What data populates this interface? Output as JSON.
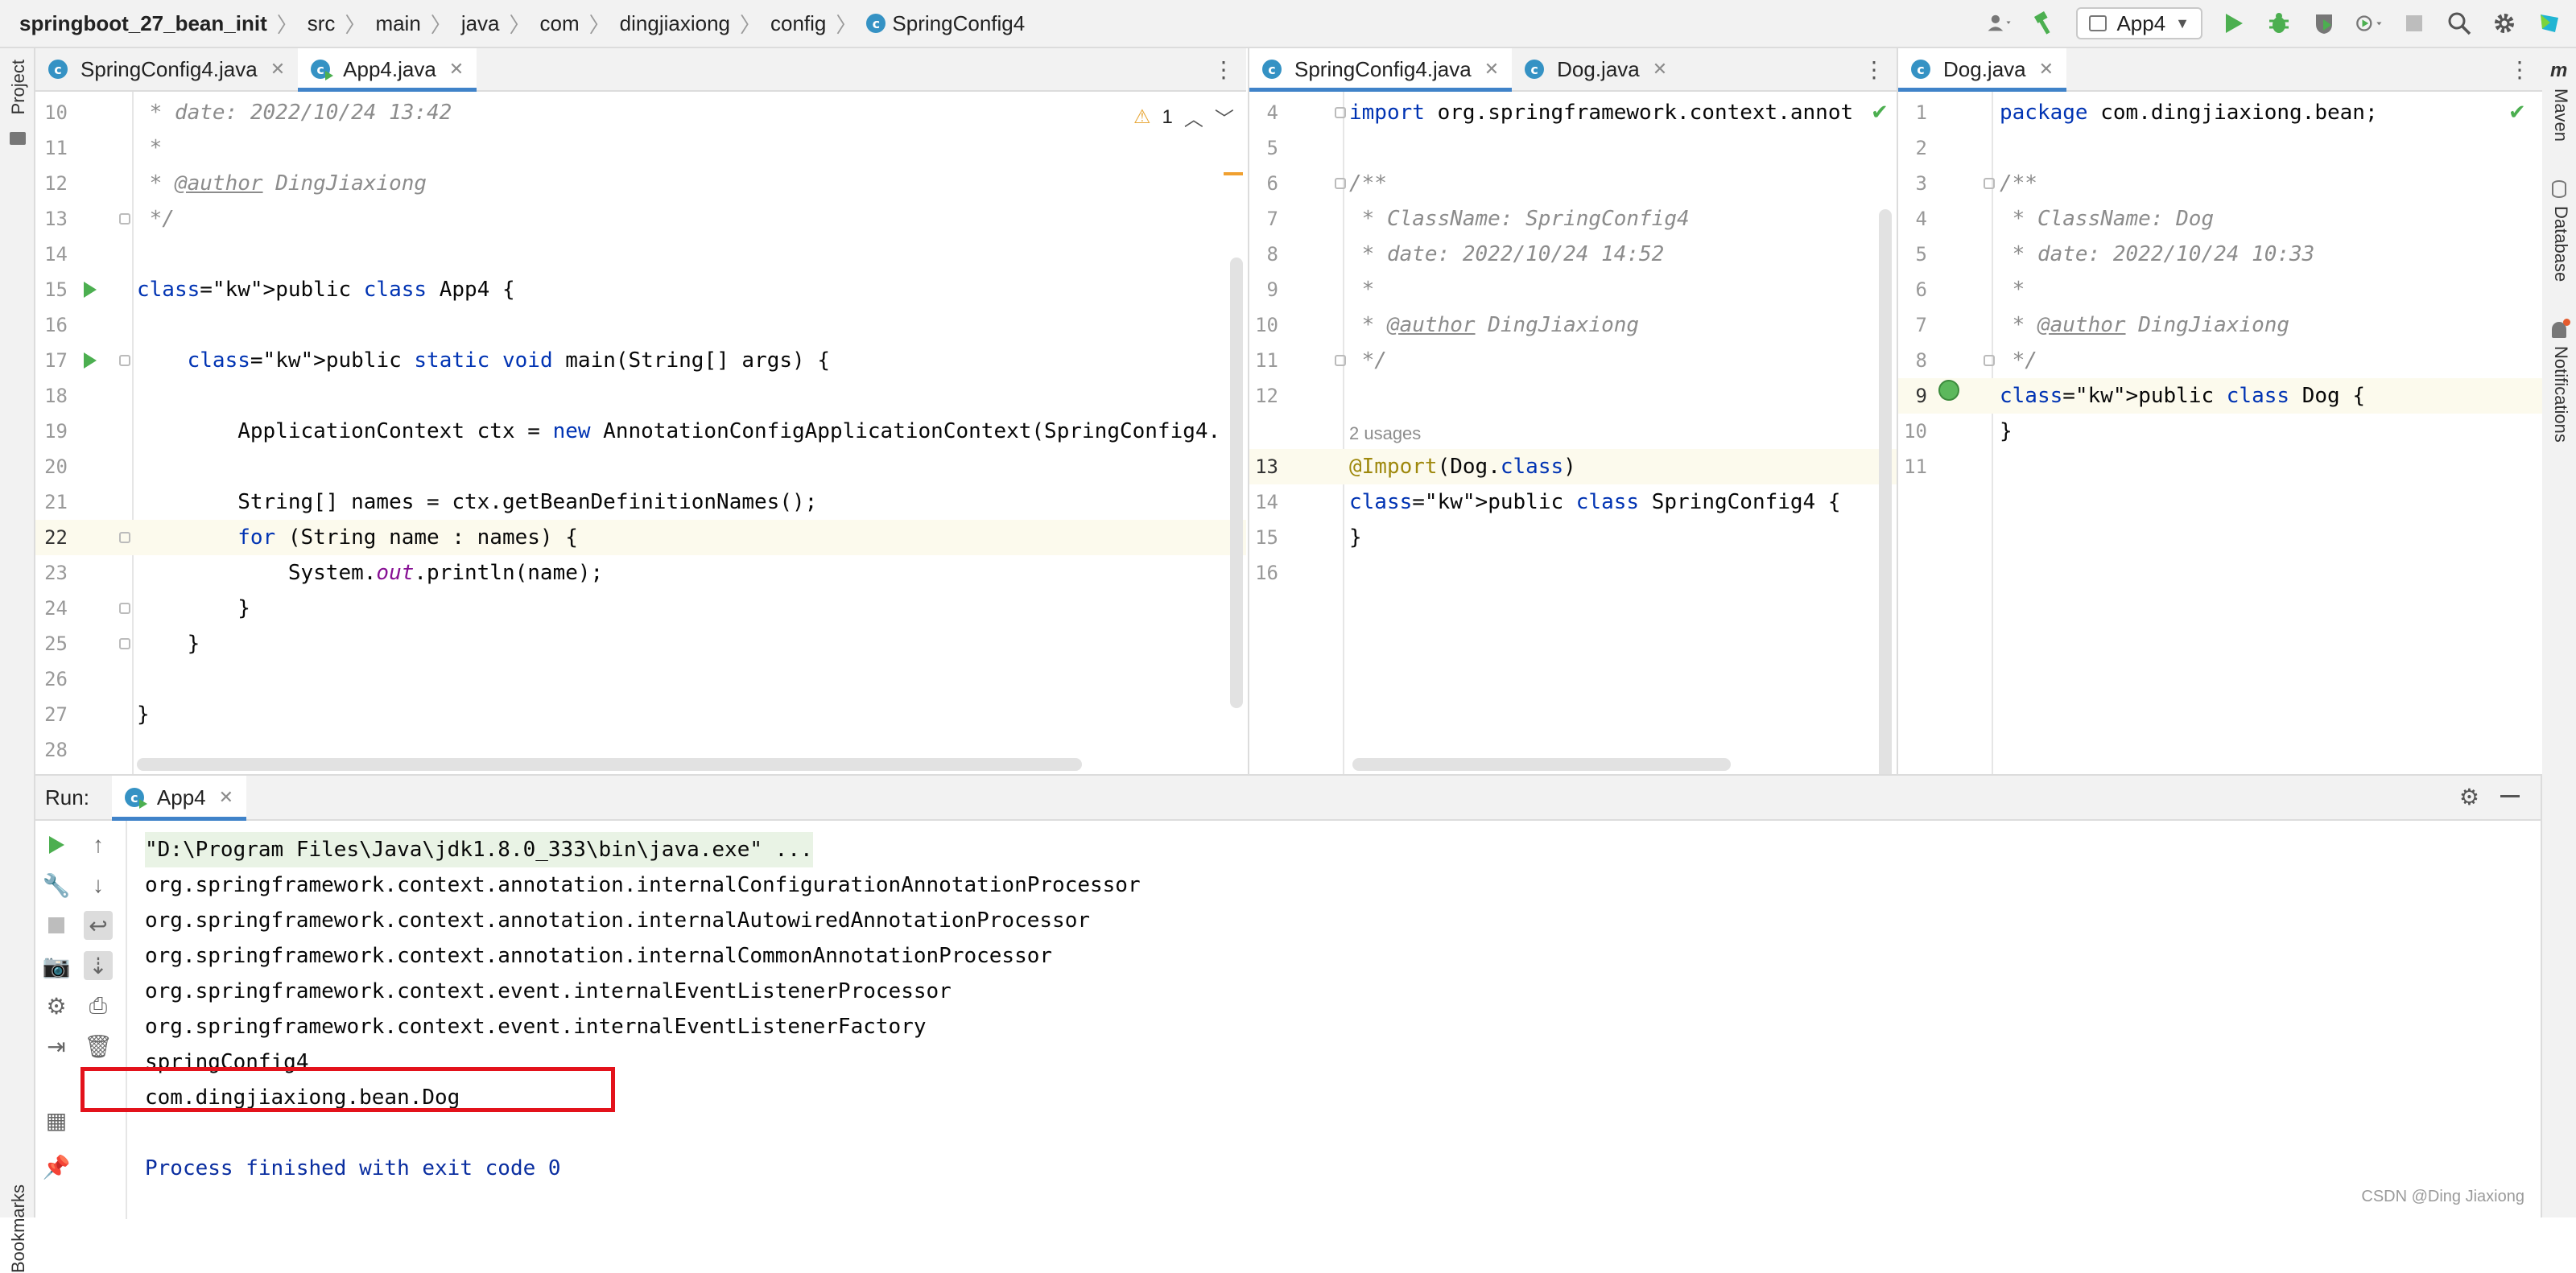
{
  "breadcrumb": [
    "springboot_27_bean_init",
    "src",
    "main",
    "java",
    "com",
    "dingjiaxiong",
    "config",
    "SpringConfig4"
  ],
  "toolbar": {
    "run_config": "App4",
    "icons": [
      "user-icon",
      "hammer-icon",
      "run-icon",
      "debug-icon",
      "coverage-icon",
      "profile-icon",
      "stop-icon",
      "search-icon",
      "gear-icon",
      "jetbrains-icon"
    ]
  },
  "left_stripe": {
    "project": "Project",
    "bookmarks": "Bookmarks"
  },
  "right_stripe": {
    "maven": "Maven",
    "database": "Database",
    "notifications": "Notifications"
  },
  "editor1": {
    "tabs": [
      {
        "label": "SpringConfig4.java",
        "active": false
      },
      {
        "label": "App4.java",
        "active": true
      }
    ],
    "warning_count": "1",
    "lines": [
      {
        "n": "10",
        "text": " * date: 2022/10/24 13:42"
      },
      {
        "n": "11",
        "text": " *"
      },
      {
        "n": "12",
        "text": " * @author DingJiaxiong"
      },
      {
        "n": "13",
        "text": " */"
      },
      {
        "n": "14",
        "text": ""
      },
      {
        "n": "15",
        "text": "public class App4 {"
      },
      {
        "n": "16",
        "text": ""
      },
      {
        "n": "17",
        "text": "    public static void main(String[] args) {"
      },
      {
        "n": "18",
        "text": ""
      },
      {
        "n": "19",
        "text": "        ApplicationContext ctx = new AnnotationConfigApplicationContext(SpringConfig4."
      },
      {
        "n": "20",
        "text": ""
      },
      {
        "n": "21",
        "text": "        String[] names = ctx.getBeanDefinitionNames();"
      },
      {
        "n": "22",
        "text": "        for (String name : names) {"
      },
      {
        "n": "23",
        "text": "            System.out.println(name);"
      },
      {
        "n": "24",
        "text": "        }"
      },
      {
        "n": "25",
        "text": "    }"
      },
      {
        "n": "26",
        "text": ""
      },
      {
        "n": "27",
        "text": "}"
      },
      {
        "n": "28",
        "text": ""
      }
    ]
  },
  "editor2": {
    "tabs": [
      {
        "label": "SpringConfig4.java",
        "active": true
      },
      {
        "label": "Dog.java",
        "active": false
      }
    ],
    "usages": "2 usages",
    "lines": [
      {
        "n": "4",
        "text": "import org.springframework.context.annot"
      },
      {
        "n": "5",
        "text": ""
      },
      {
        "n": "6",
        "text": "/**"
      },
      {
        "n": "7",
        "text": " * ClassName: SpringConfig4"
      },
      {
        "n": "8",
        "text": " * date: 2022/10/24 14:52"
      },
      {
        "n": "9",
        "text": " *"
      },
      {
        "n": "10",
        "text": " * @author DingJiaxiong"
      },
      {
        "n": "11",
        "text": " */"
      },
      {
        "n": "12",
        "text": ""
      },
      {
        "n": "13",
        "text": "@Import(Dog.class)"
      },
      {
        "n": "14",
        "text": "public class SpringConfig4 {"
      },
      {
        "n": "15",
        "text": "}"
      },
      {
        "n": "16",
        "text": ""
      }
    ]
  },
  "editor3": {
    "tabs": [
      {
        "label": "Dog.java",
        "active": true
      }
    ],
    "lines": [
      {
        "n": "1",
        "text": "package com.dingjiaxiong.bean;"
      },
      {
        "n": "2",
        "text": ""
      },
      {
        "n": "3",
        "text": "/**"
      },
      {
        "n": "4",
        "text": " * ClassName: Dog"
      },
      {
        "n": "5",
        "text": " * date: 2022/10/24 10:33"
      },
      {
        "n": "6",
        "text": " *"
      },
      {
        "n": "7",
        "text": " * @author DingJiaxiong"
      },
      {
        "n": "8",
        "text": " */"
      },
      {
        "n": "9",
        "text": "public class Dog {"
      },
      {
        "n": "10",
        "text": "}"
      },
      {
        "n": "11",
        "text": ""
      }
    ]
  },
  "run": {
    "label": "Run:",
    "tab": "App4",
    "output": [
      "\"D:\\Program Files\\Java\\jdk1.8.0_333\\bin\\java.exe\" ...",
      "org.springframework.context.annotation.internalConfigurationAnnotationProcessor",
      "org.springframework.context.annotation.internalAutowiredAnnotationProcessor",
      "org.springframework.context.annotation.internalCommonAnnotationProcessor",
      "org.springframework.context.event.internalEventListenerProcessor",
      "org.springframework.context.event.internalEventListenerFactory",
      "springConfig4",
      "com.dingjiaxiong.bean.Dog",
      "",
      "Process finished with exit code 0"
    ]
  },
  "watermark": "CSDN @Ding Jiaxiong",
  "colors": {
    "keyword": "#0033b3",
    "comment": "#8c8c8c",
    "annotation": "#9e880d",
    "highlight_box": "#e3121b",
    "accent": "#4083c9"
  }
}
